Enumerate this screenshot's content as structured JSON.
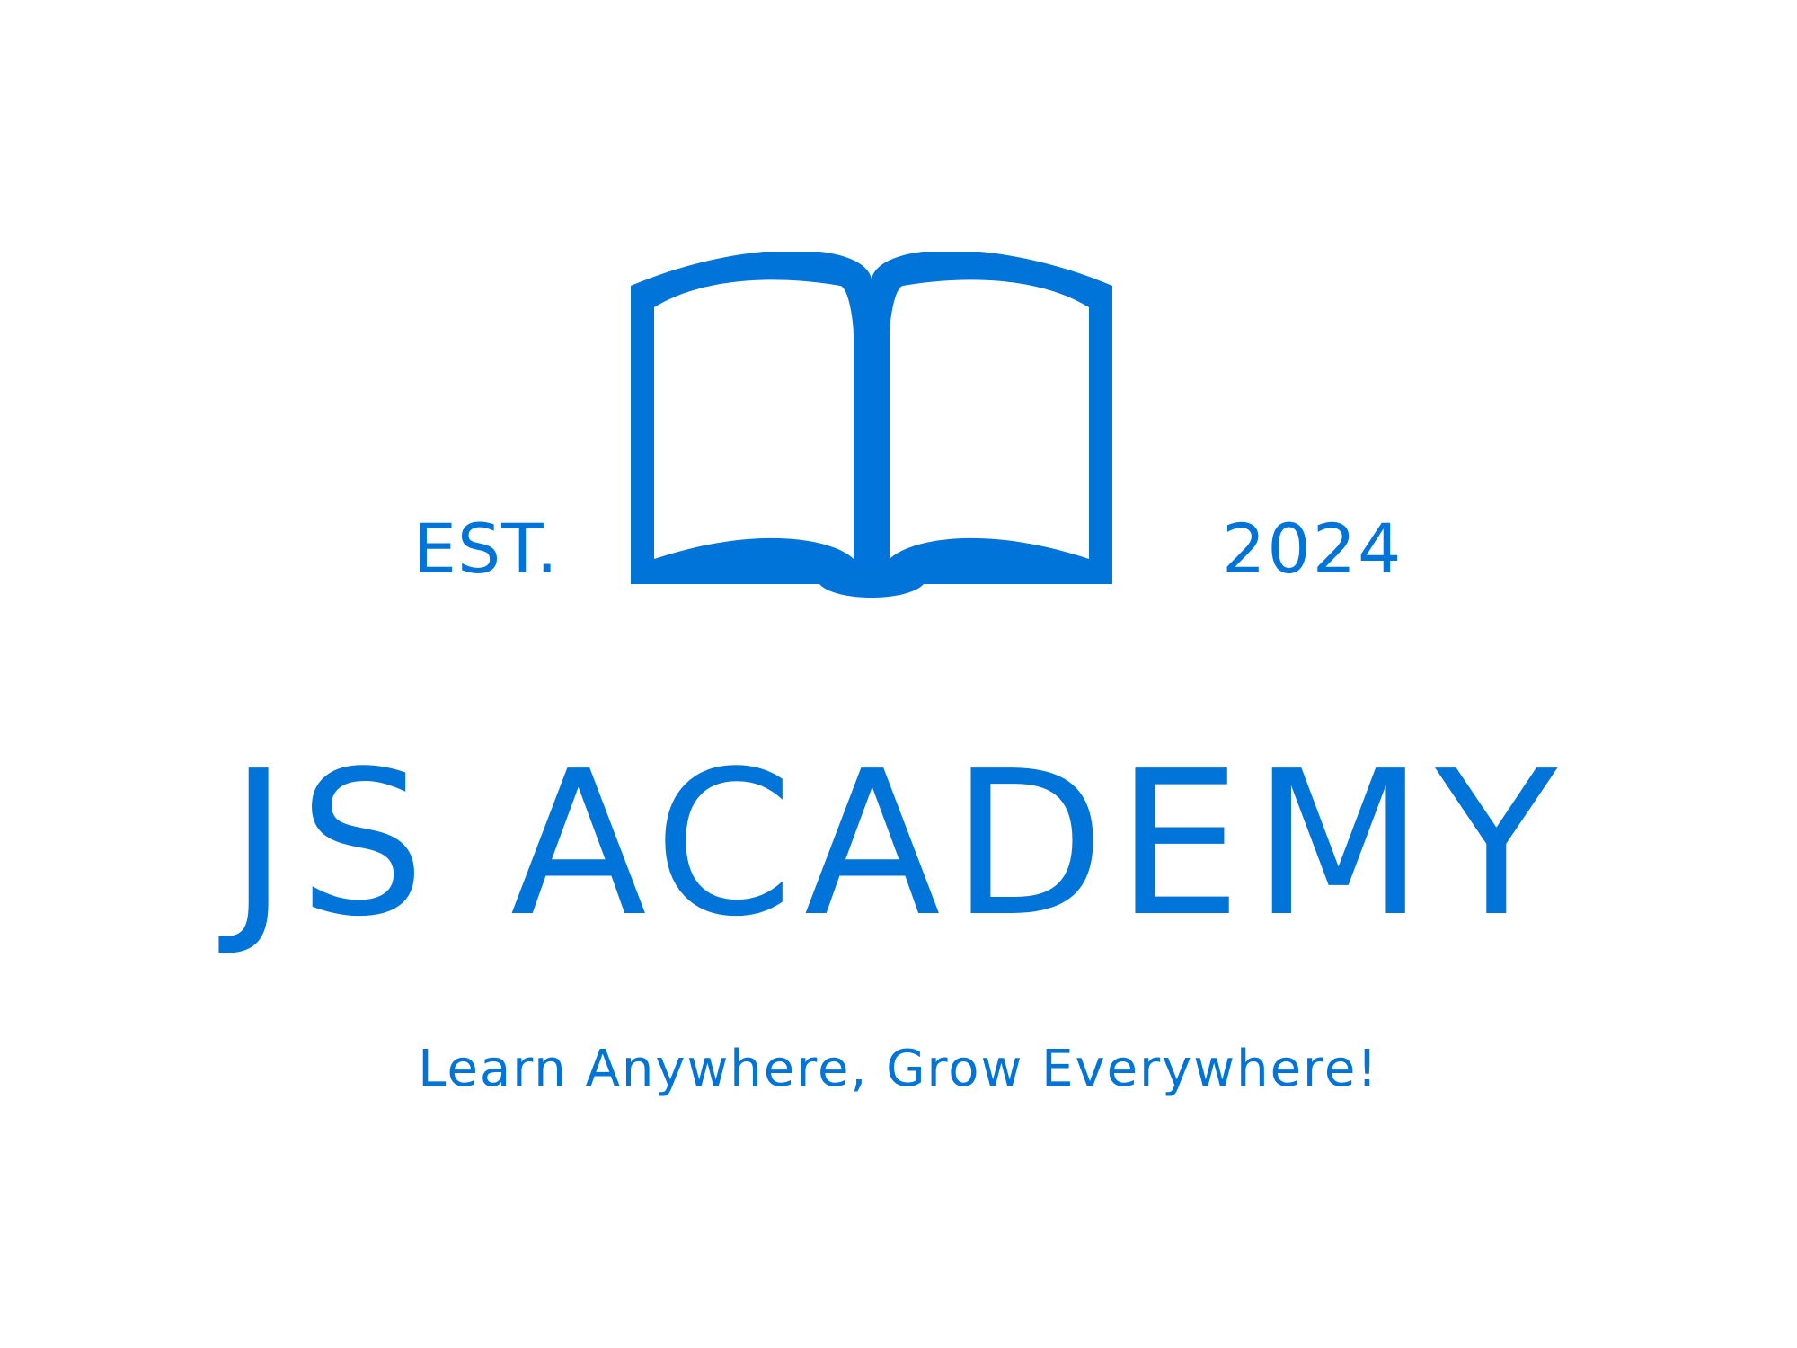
{
  "logo": {
    "icon": "open-book-icon",
    "est_label": "EST.",
    "year": "2024",
    "name": "JS ACADEMY",
    "tagline": "Learn Anywhere, Grow Everywhere!",
    "colors": {
      "brand": "#0074d9",
      "background": "#ffffff"
    }
  }
}
